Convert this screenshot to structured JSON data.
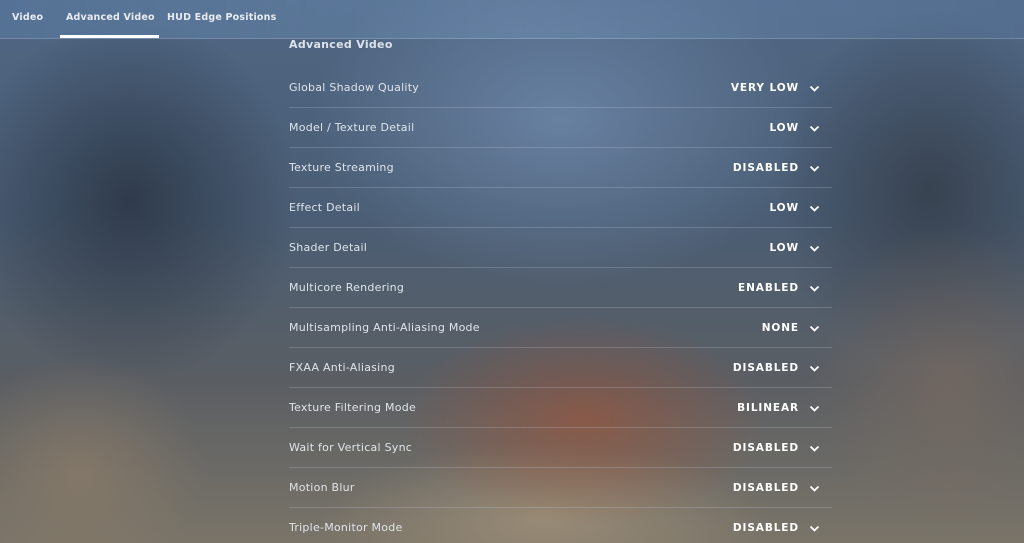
{
  "tabs": [
    {
      "label": "Video",
      "active": false
    },
    {
      "label": "Advanced Video",
      "active": true
    },
    {
      "label": "HUD Edge Positions",
      "active": false
    }
  ],
  "section": {
    "title": "Advanced Video"
  },
  "settings": [
    {
      "label": "Global Shadow Quality",
      "value": "VERY LOW"
    },
    {
      "label": "Model / Texture Detail",
      "value": "LOW"
    },
    {
      "label": "Texture Streaming",
      "value": "DISABLED"
    },
    {
      "label": "Effect Detail",
      "value": "LOW"
    },
    {
      "label": "Shader Detail",
      "value": "LOW"
    },
    {
      "label": "Multicore Rendering",
      "value": "ENABLED"
    },
    {
      "label": "Multisampling Anti-Aliasing Mode",
      "value": "NONE"
    },
    {
      "label": "FXAA Anti-Aliasing",
      "value": "DISABLED"
    },
    {
      "label": "Texture Filtering Mode",
      "value": "BILINEAR"
    },
    {
      "label": "Wait for Vertical Sync",
      "value": "DISABLED"
    },
    {
      "label": "Motion Blur",
      "value": "DISABLED"
    },
    {
      "label": "Triple-Monitor Mode",
      "value": "DISABLED"
    }
  ],
  "icons": {
    "dropdown": "chevron-down-icon"
  },
  "colors": {
    "accent": "#ffffff",
    "divider": "#d2dce8"
  }
}
